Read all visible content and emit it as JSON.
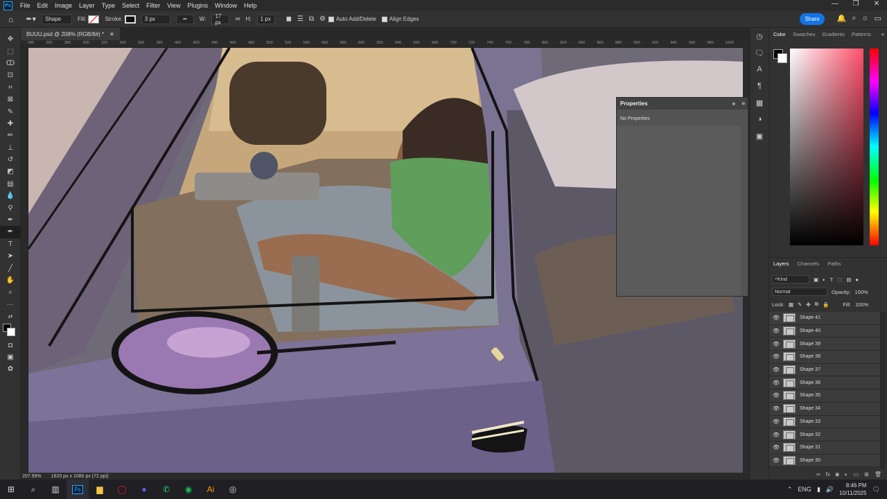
{
  "menubar": {
    "logo": "Ps",
    "items": [
      "File",
      "Edit",
      "Image",
      "Layer",
      "Type",
      "Select",
      "Filter",
      "View",
      "Plugins",
      "Window",
      "Help"
    ]
  },
  "options": {
    "mode": "Shape",
    "fill_label": "Fill:",
    "stroke_label": "Stroke:",
    "stroke_width": "3 px",
    "w_label": "W:",
    "w_value": "17 px",
    "h_label": "H:",
    "h_value": "1 px",
    "auto_add_delete": "Auto Add/Delete",
    "align_edges": "Align Edges",
    "share": "Share"
  },
  "document": {
    "tab_title": "BUUU.psd @ 208% (RGB/8#) *",
    "zoom": "207.99%",
    "info": "1920 px x 1080 px (72 ppi)"
  },
  "ruler": {
    "ticks": [
      "240",
      "260",
      "280",
      "300",
      "320",
      "340",
      "360",
      "380",
      "400",
      "420",
      "440",
      "460",
      "480",
      "500",
      "520",
      "540",
      "560",
      "580",
      "600",
      "620",
      "640",
      "660",
      "680",
      "700",
      "720",
      "740",
      "760",
      "780",
      "800",
      "820",
      "840",
      "860",
      "880",
      "900",
      "920",
      "940",
      "960",
      "980",
      "1000"
    ]
  },
  "properties": {
    "title": "Properties",
    "body": "No Properties"
  },
  "color_panel": {
    "tabs": [
      "Color",
      "Swatches",
      "Gradients",
      "Patterns"
    ],
    "foreground": "#000000",
    "background": "#ffffff"
  },
  "layers_panel": {
    "tabs": [
      "Layers",
      "Channels",
      "Paths"
    ],
    "filter": "Kind",
    "blend_mode": "Normal",
    "opacity_label": "Opacity:",
    "opacity_value": "100%",
    "lock_label": "Lock:",
    "fill_label": "Fill:",
    "fill_value": "100%",
    "layers": [
      "Shape 41",
      "Shape 40",
      "Shape 39",
      "Shape 38",
      "Shape 37",
      "Shape 36",
      "Shape 35",
      "Shape 34",
      "Shape 33",
      "Shape 32",
      "Shape 31",
      "Shape 30"
    ]
  },
  "taskbar": {
    "language": "ENG",
    "time": "8:46 PM",
    "date": "10/11/2025"
  }
}
